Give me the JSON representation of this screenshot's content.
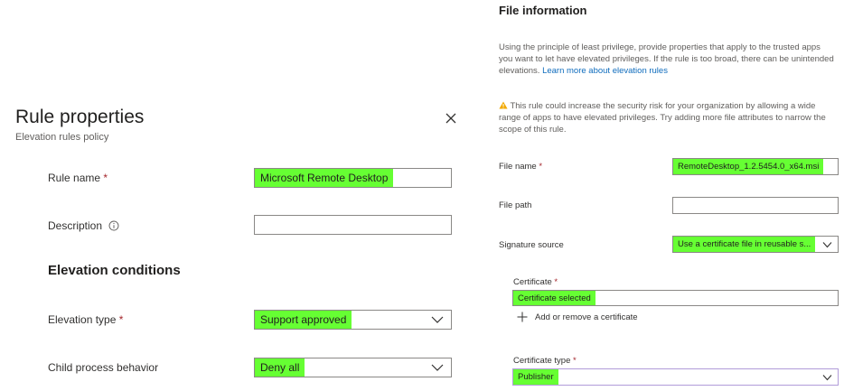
{
  "panel": {
    "title": "Rule properties",
    "subtitle": "Elevation rules policy",
    "fields": {
      "rule_name": {
        "label": "Rule name",
        "required": "*",
        "value": "Microsoft Remote Desktop"
      },
      "description": {
        "label": "Description",
        "value": ""
      },
      "elevation_type": {
        "label": "Elevation type",
        "required": "*",
        "value": "Support approved"
      },
      "child_process": {
        "label": "Child process behavior",
        "value": "Deny all"
      }
    },
    "section_heading": "Elevation conditions"
  },
  "file_info": {
    "title": "File information",
    "intro_text": "Using the principle of least privilege, provide properties that apply to the trusted apps you want to let have elevated privileges. If the rule is too broad, there can be unintended elevations.",
    "intro_link": "Learn more about elevation rules",
    "warning_text": "This rule could increase the security risk for your organization by allowing a wide range of apps to have elevated privileges. Try adding more file attributes to narrow the scope of this rule.",
    "file_name": {
      "label": "File name",
      "required": "*",
      "value": "RemoteDesktop_1.2.5454.0_x64.msi"
    },
    "file_path": {
      "label": "File path",
      "value": ""
    },
    "signature_source": {
      "label": "Signature source",
      "value": "Use a certificate file in reusable s..."
    },
    "certificate": {
      "label": "Certificate",
      "required": "*",
      "value": "Certificate selected"
    },
    "add_certificate": "Add or remove a certificate",
    "certificate_type": {
      "label": "Certificate type",
      "required": "*",
      "value": "Publisher"
    }
  },
  "colors": {
    "highlight": "#66ff33",
    "link": "#0f6cbd",
    "warning": "#f2a900",
    "required": "#a4262c"
  }
}
